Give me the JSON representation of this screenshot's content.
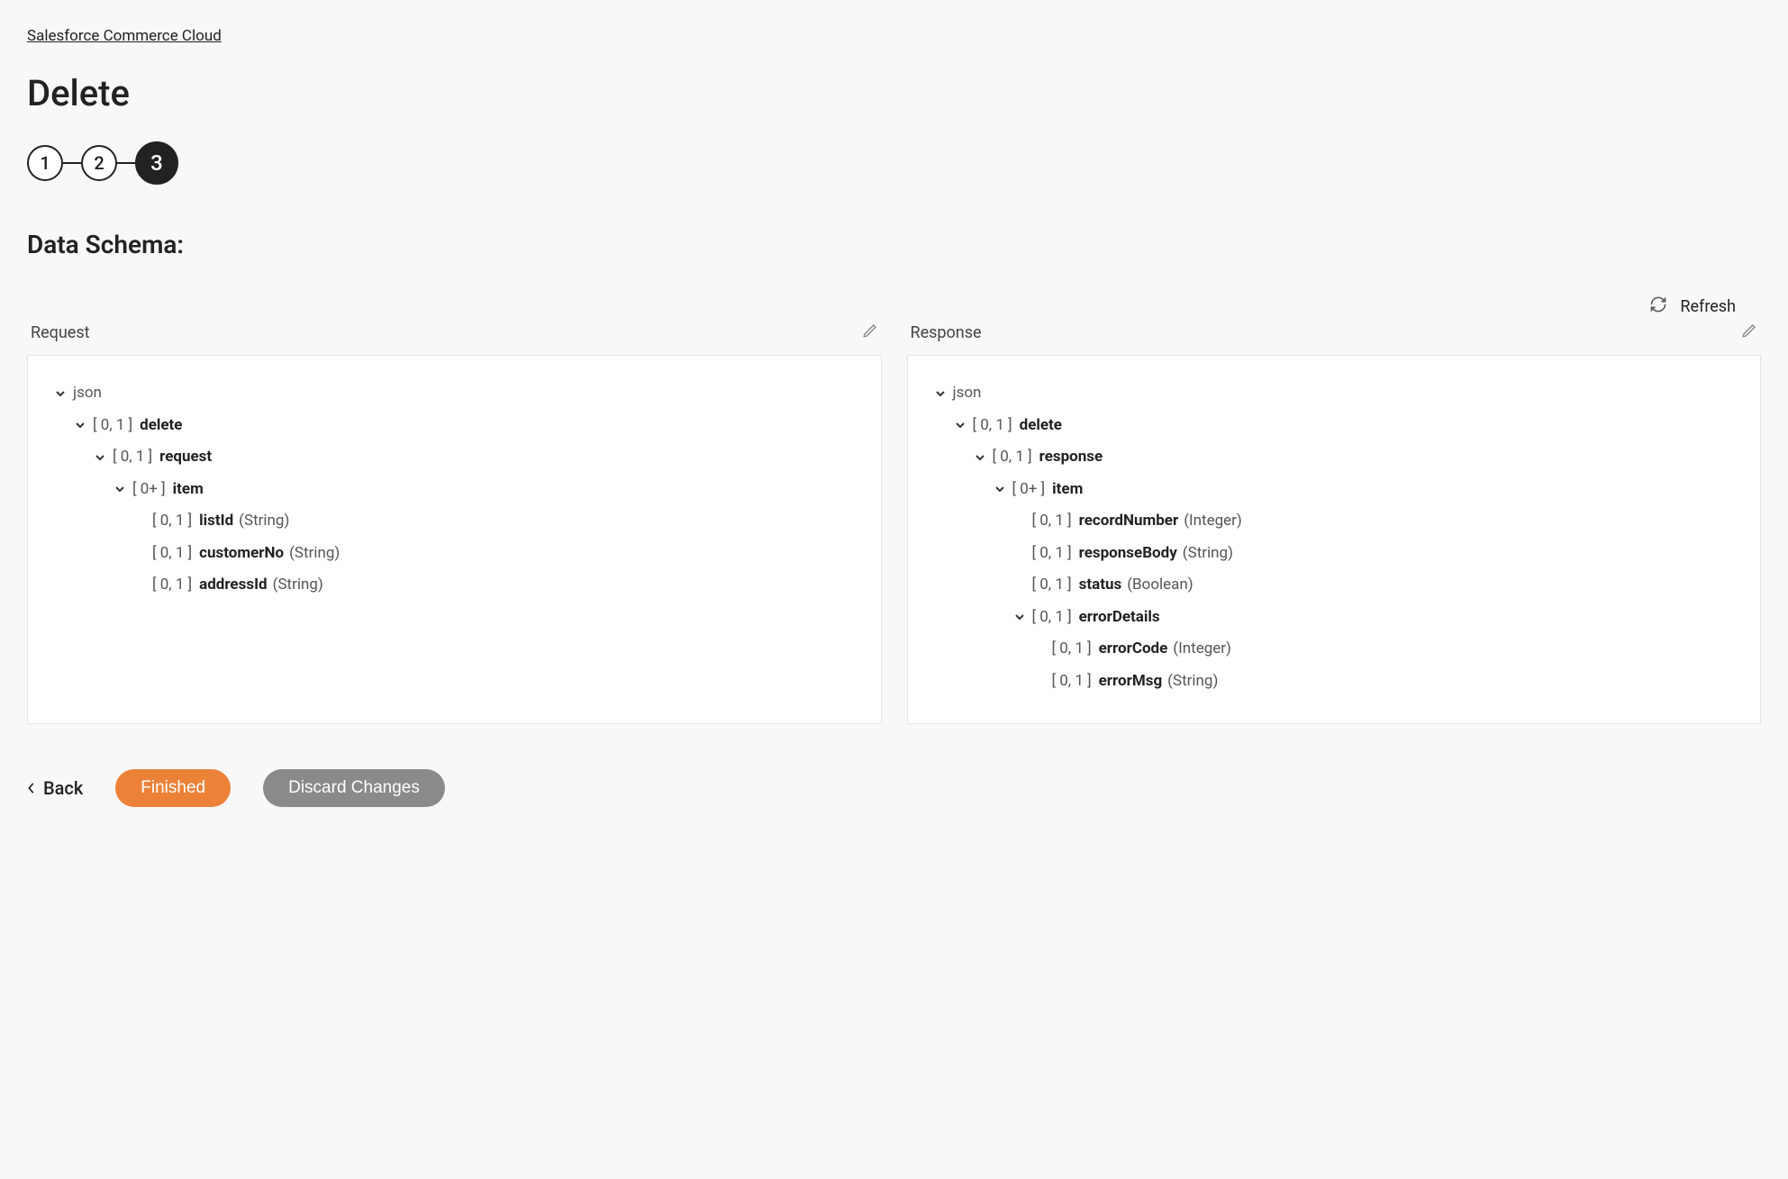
{
  "breadcrumb": {
    "label": "Salesforce Commerce Cloud"
  },
  "page": {
    "title": "Delete"
  },
  "stepper": {
    "steps": [
      {
        "label": "1",
        "active": false
      },
      {
        "label": "2",
        "active": false
      },
      {
        "label": "3",
        "active": true
      }
    ]
  },
  "section": {
    "title": "Data Schema:"
  },
  "refresh": {
    "label": "Refresh"
  },
  "panels": {
    "request": {
      "label": "Request",
      "tree": [
        {
          "indent": 0,
          "chevron": true,
          "card": "",
          "name": "json",
          "type": "",
          "bold": false
        },
        {
          "indent": 1,
          "chevron": true,
          "card": "[ 0, 1 ]",
          "name": "delete",
          "type": "",
          "bold": true
        },
        {
          "indent": 2,
          "chevron": true,
          "card": "[ 0, 1 ]",
          "name": "request",
          "type": "",
          "bold": true
        },
        {
          "indent": 3,
          "chevron": true,
          "card": "[ 0+ ]",
          "name": "item",
          "type": "",
          "bold": true
        },
        {
          "indent": 4,
          "chevron": false,
          "card": "[ 0, 1 ]",
          "name": "listId",
          "type": "(String)",
          "bold": true
        },
        {
          "indent": 4,
          "chevron": false,
          "card": "[ 0, 1 ]",
          "name": "customerNo",
          "type": "(String)",
          "bold": true
        },
        {
          "indent": 4,
          "chevron": false,
          "card": "[ 0, 1 ]",
          "name": "addressId",
          "type": "(String)",
          "bold": true
        }
      ]
    },
    "response": {
      "label": "Response",
      "tree": [
        {
          "indent": 0,
          "chevron": true,
          "card": "",
          "name": "json",
          "type": "",
          "bold": false
        },
        {
          "indent": 1,
          "chevron": true,
          "card": "[ 0, 1 ]",
          "name": "delete",
          "type": "",
          "bold": true
        },
        {
          "indent": 2,
          "chevron": true,
          "card": "[ 0, 1 ]",
          "name": "response",
          "type": "",
          "bold": true
        },
        {
          "indent": 3,
          "chevron": true,
          "card": "[ 0+ ]",
          "name": "item",
          "type": "",
          "bold": true
        },
        {
          "indent": 4,
          "chevron": false,
          "card": "[ 0, 1 ]",
          "name": "recordNumber",
          "type": "(Integer)",
          "bold": true
        },
        {
          "indent": 4,
          "chevron": false,
          "card": "[ 0, 1 ]",
          "name": "responseBody",
          "type": "(String)",
          "bold": true
        },
        {
          "indent": 4,
          "chevron": false,
          "card": "[ 0, 1 ]",
          "name": "status",
          "type": "(Boolean)",
          "bold": true
        },
        {
          "indent": 4,
          "chevron": true,
          "card": "[ 0, 1 ]",
          "name": "errorDetails",
          "type": "",
          "bold": true
        },
        {
          "indent": 5,
          "chevron": false,
          "card": "[ 0, 1 ]",
          "name": "errorCode",
          "type": "(Integer)",
          "bold": true
        },
        {
          "indent": 5,
          "chevron": false,
          "card": "[ 0, 1 ]",
          "name": "errorMsg",
          "type": "(String)",
          "bold": true
        }
      ]
    }
  },
  "footer": {
    "back": "Back",
    "finished": "Finished",
    "discard": "Discard Changes"
  }
}
